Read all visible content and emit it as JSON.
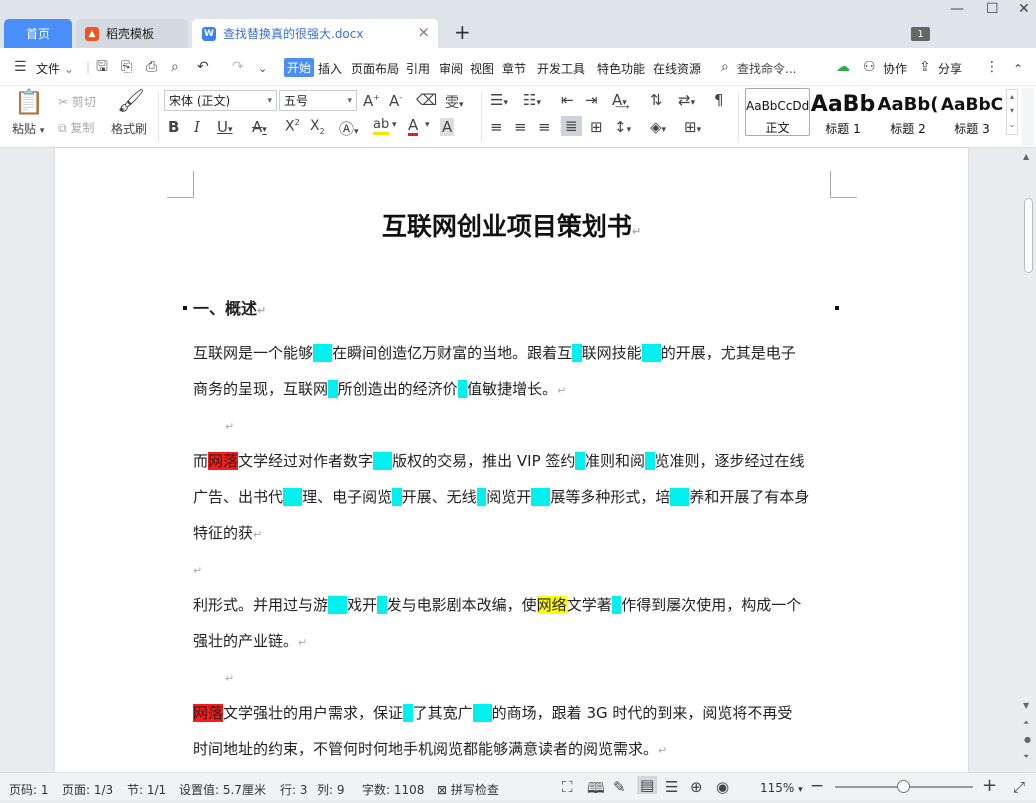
{
  "tabs": {
    "home": "首页",
    "templates": "稻壳模板",
    "doc": "查找替换真的很强大.docx",
    "window_badge": "1"
  },
  "menu": {
    "file": "文件",
    "items": [
      "开始",
      "插入",
      "页面布局",
      "引用",
      "审阅",
      "视图",
      "章节",
      "开发工具",
      "特色功能",
      "在线资源"
    ],
    "search": "查找命令...",
    "collab": "协作",
    "share": "分享"
  },
  "ribbon": {
    "paste": "粘贴",
    "cut": "剪切",
    "copy": "复制",
    "format_painter": "格式刷",
    "font": "宋体 (正文)",
    "size": "五号",
    "styles": [
      {
        "preview": "AaBbCcDd",
        "name": "正文"
      },
      {
        "preview": "AaBb",
        "name": "标题 1"
      },
      {
        "preview": "AaBb(",
        "name": "标题 2"
      },
      {
        "preview": "AaBbC",
        "name": "标题 3"
      }
    ]
  },
  "document": {
    "title": "互联网创业项目策划书",
    "heading": "一、概述",
    "paragraphs": [
      [
        "互联网是一个能够",
        {
          "h": "cy",
          "t": "  "
        },
        "在瞬间创造亿万财富的当地。跟着互",
        {
          "h": "cy",
          "t": " "
        },
        "联网技能",
        {
          "h": "cy",
          "t": "  "
        },
        "的开展，尤其是电子"
      ],
      [
        "商务的呈现，互联网",
        {
          "h": "cy",
          "t": " "
        },
        "所创造出的经济价",
        {
          "h": "cy",
          "t": " "
        },
        "值敏捷增长。"
      ],
      [
        "↵"
      ],
      [
        "而",
        {
          "h": "rd",
          "t": "网落"
        },
        "文学经过对作者数字",
        {
          "h": "cy",
          "t": "  "
        },
        "版权的交易，推出 VIP 签约",
        {
          "h": "cy",
          "t": " "
        },
        "准则和阅",
        {
          "h": "cy",
          "t": " "
        },
        "览准则，逐步经过在线"
      ],
      [
        "广告、出书代",
        {
          "h": "cy",
          "t": "  "
        },
        "理、电子阅览",
        {
          "h": "cy",
          "t": " "
        },
        "开展、无线",
        {
          "h": "cy",
          "t": " "
        },
        "阅览开",
        {
          "h": "cy",
          "t": "  "
        },
        "展等多种形式，培",
        {
          "h": "cy",
          "t": "  "
        },
        "养和开展了有本身"
      ],
      [
        "特征的获"
      ],
      [
        "↵"
      ],
      [
        "利形式。并用过与游",
        {
          "h": "cy",
          "t": "  "
        },
        "戏开",
        {
          "h": "cy",
          "t": " "
        },
        "发与电影剧本改编，使",
        {
          "h": "yl",
          "t": "网络"
        },
        "文学著",
        {
          "h": "cy",
          "t": " "
        },
        "作得到屡次使用，构成一个"
      ],
      [
        "强壮的产业链。"
      ],
      [
        "↵"
      ],
      [
        {
          "h": "rd",
          "t": "网落"
        },
        "文学强壮的用户需求，保证",
        {
          "h": "cy",
          "t": " "
        },
        "了其宽广",
        {
          "h": "cy",
          "t": "  "
        },
        "的商场，跟着 3G 时代的到来，阅览将不再受"
      ],
      [
        "时间地址的约束，不管何时何地手机阅览都能够满意读者的阅览需求。"
      ]
    ]
  },
  "status": {
    "page_num": "页码: 1",
    "pages": "页面: 1/3",
    "section": "节: 1/1",
    "setting": "设置值: 5.7厘米",
    "row": "行: 3",
    "col": "列: 9",
    "words": "字数: 1108",
    "spell": "拼写检查",
    "zoom": "115%"
  },
  "colors": {
    "accent": "#4a8ef8",
    "highlight_cyan": "#00f0f0",
    "highlight_red": "#ff1a1a",
    "highlight_yellow": "#ffff00"
  }
}
